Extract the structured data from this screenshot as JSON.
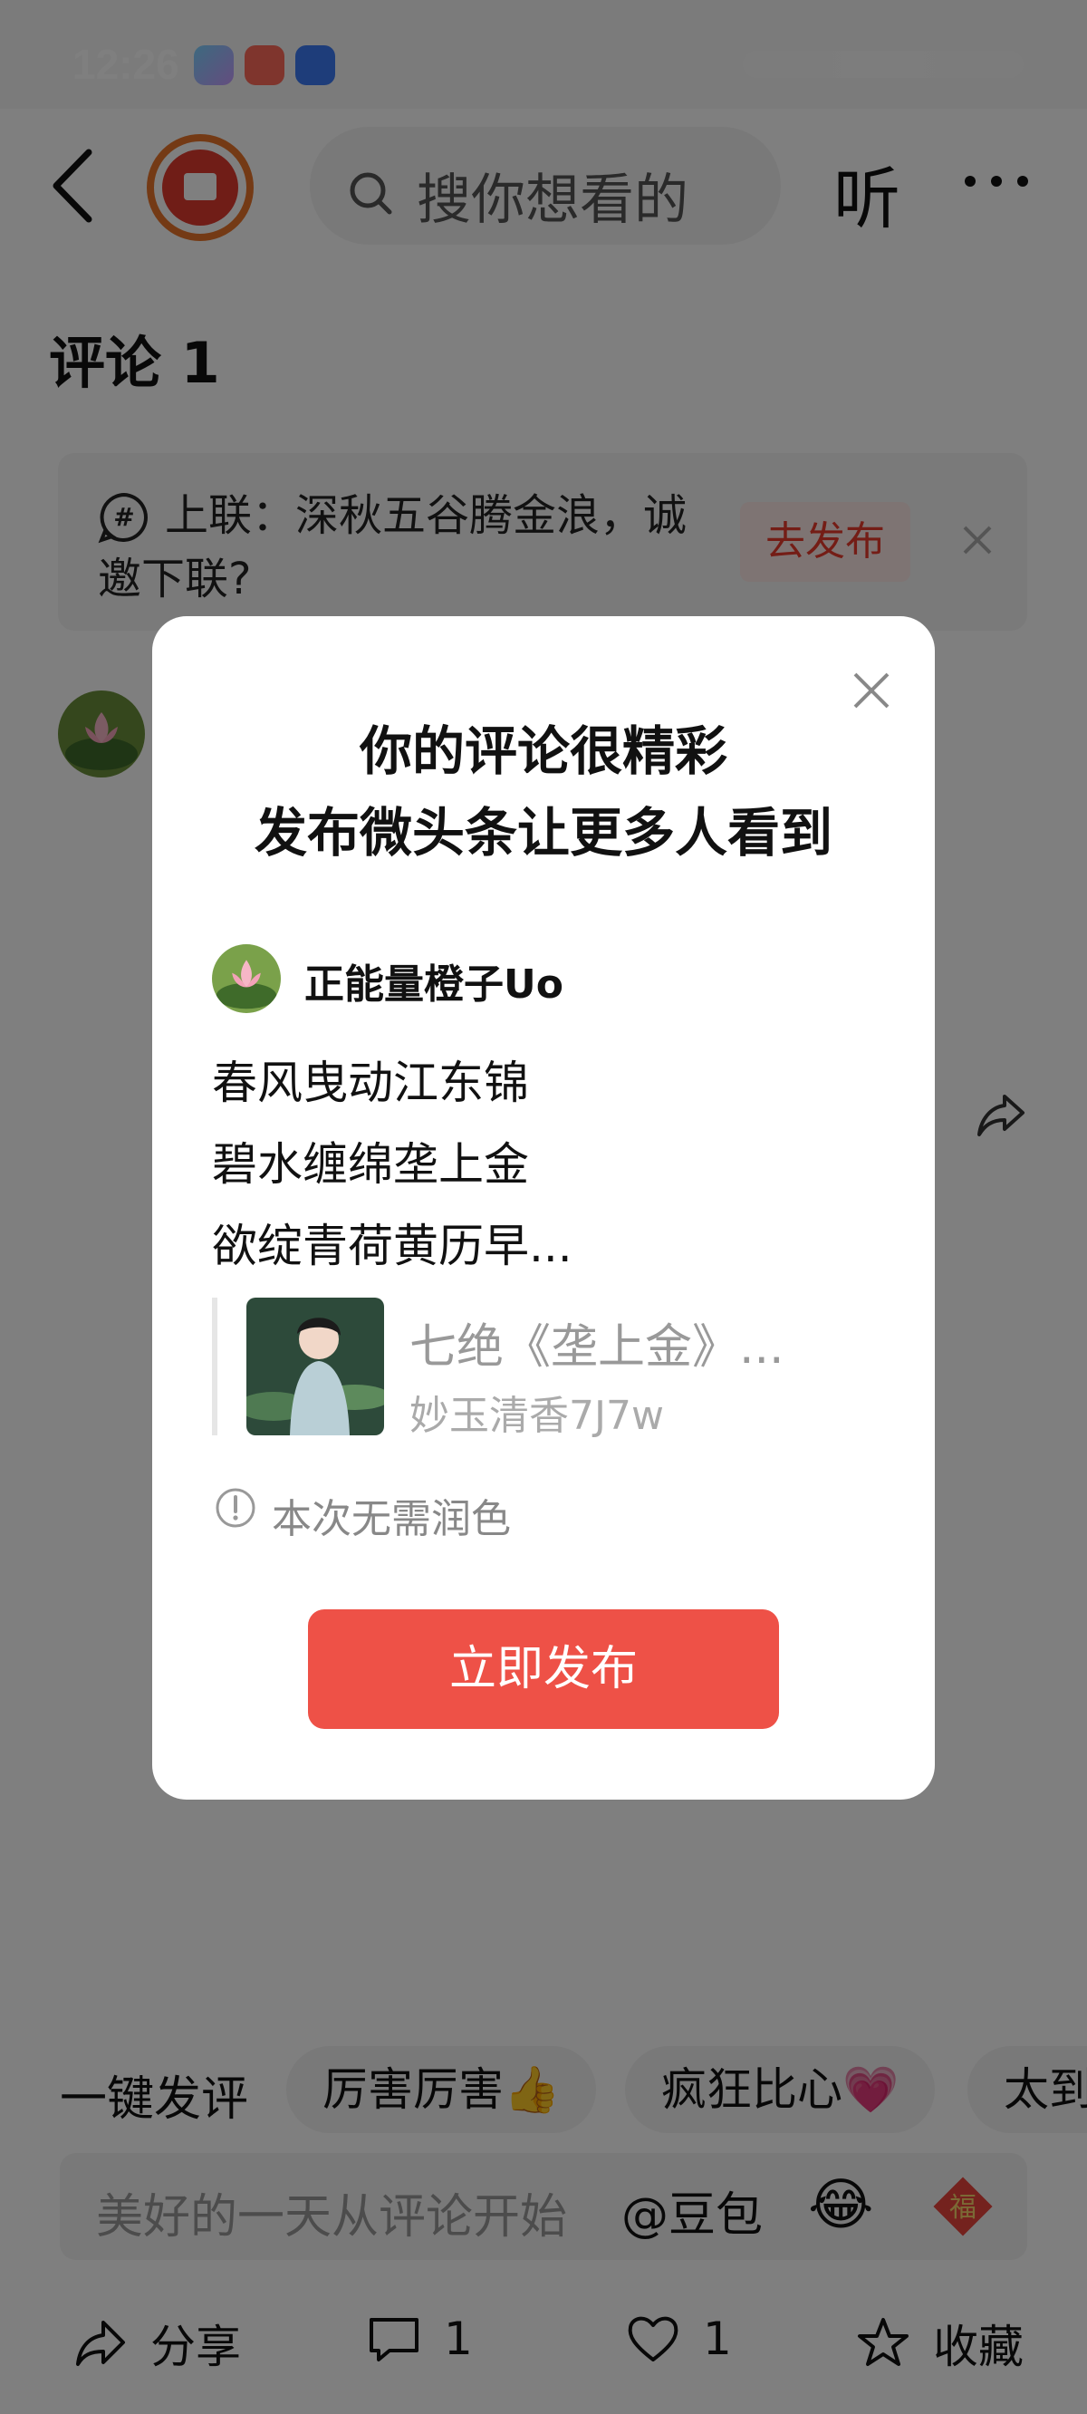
{
  "status_bar": {
    "time": "12:26"
  },
  "header": {
    "search_placeholder": "搜你想看的",
    "listen_label": "听"
  },
  "comments": {
    "title": "评论 1"
  },
  "topic": {
    "text": "上联：深秋五谷腾金浪，诚邀下联?",
    "go_label": "去发布"
  },
  "quick_comment": {
    "label": "一键发评",
    "chips": [
      "厉害厉害👍",
      "疯狂比心💗",
      "太到"
    ]
  },
  "input": {
    "placeholder": "美好的一天从评论开始",
    "mention": "@豆包",
    "fu_char": "福"
  },
  "actions": {
    "share": "分享",
    "comment_count": "1",
    "like_count": "1",
    "collect": "收藏"
  },
  "dialog": {
    "title_line1": "你的评论很精彩",
    "title_line2": "发布微头条让更多人看到",
    "author": "正能量橙子Uo",
    "poem_lines": [
      "春风曳动江东锦",
      "碧水缠绵垄上金",
      "欲绽青荷黄历早..."
    ],
    "quote_title": "七绝《垄上金》...",
    "quote_author": "妙玉清香7J7w",
    "info": "本次无需润色",
    "publish_label": "立即发布"
  },
  "colors": {
    "accent_red": "#ee5147",
    "topic_red": "#e83a2c",
    "overlay": "rgba(0,0,0,0.5)"
  }
}
